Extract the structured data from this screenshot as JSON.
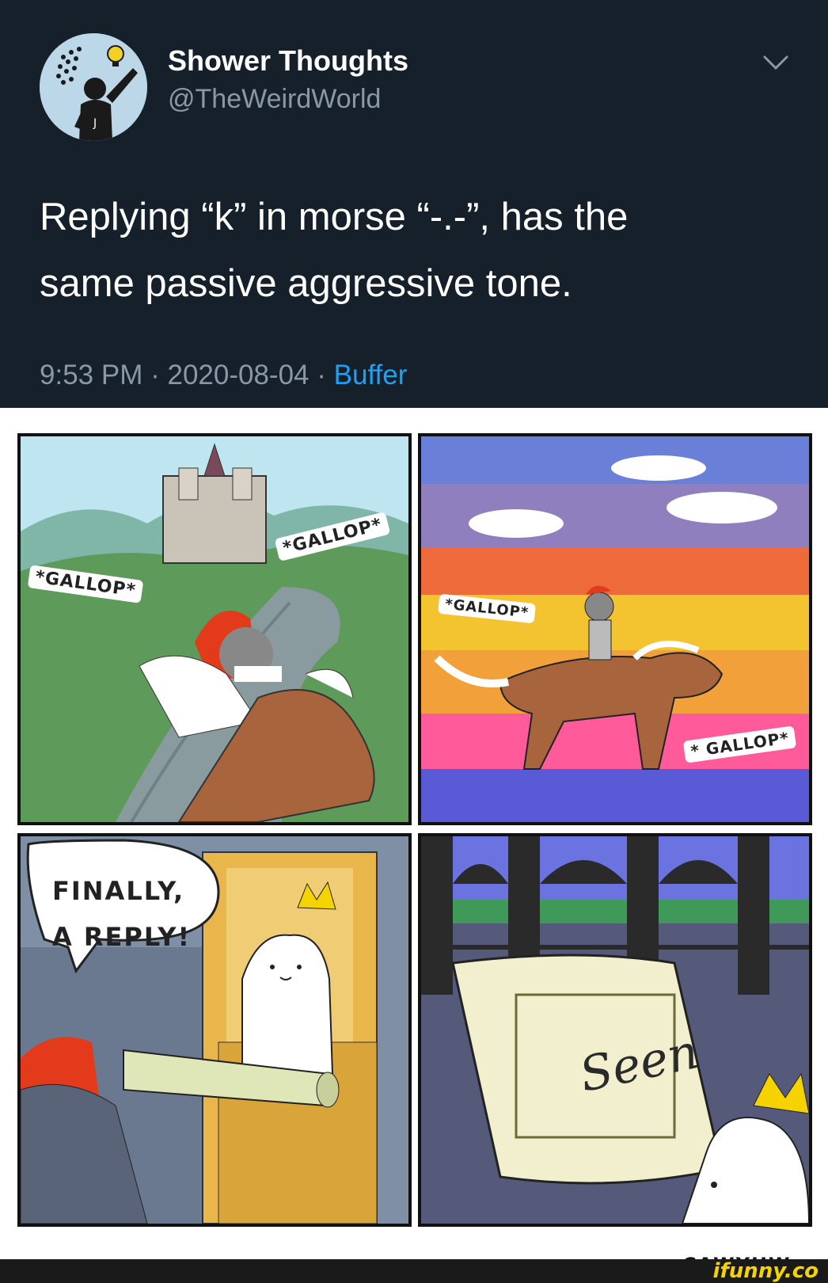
{
  "tweet": {
    "author_name": "Shower Thoughts",
    "author_handle": "@TheWeirdWorld",
    "text_line1": "Replying “k” in morse “-.-”, has the",
    "text_line2": "same passive aggressive tone.",
    "time": "9:53 PM",
    "separator": "·",
    "date": "2020-08-04",
    "source": "Buffer",
    "menu_icon": "chevron-down-icon",
    "colors": {
      "background": "#15202b",
      "secondary_text": "#8899a6",
      "link": "#1da1f2"
    }
  },
  "comic": {
    "panel1": {
      "sfx_left": "*GALLOP*",
      "sfx_right": "*GALLOP*"
    },
    "panel2": {
      "sfx_left": "*GALLOP*",
      "sfx_right": "* GALLOP*"
    },
    "panel3": {
      "speech_line1": "FINALLY,",
      "speech_line2": "A REPLY!"
    },
    "panel4": {
      "scroll_text": "Seen"
    },
    "signature": "CAWYHW"
  },
  "footer": {
    "watermark": "ifunny.co"
  }
}
